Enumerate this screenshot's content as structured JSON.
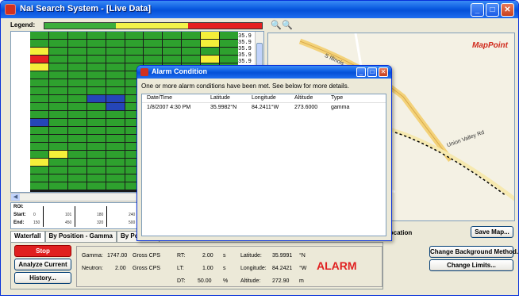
{
  "window": {
    "title": "NaI Search System - [Live Data]",
    "minimize": "_",
    "maximize": "□",
    "close": "✕"
  },
  "legend": {
    "label": "Legend:",
    "segments": [
      {
        "color": "#3cae3c",
        "fraction": 0.33
      },
      {
        "color": "#f3f349",
        "fraction": 0.33
      },
      {
        "color": "#e62020",
        "fraction": 0.34
      }
    ]
  },
  "waterfall": {
    "side_values": [
      "35.9",
      "35.9",
      "35.9",
      "35.9",
      "35.9"
    ],
    "rows": [
      "GGGGGGGGGYG",
      "GGGGGGGGGYG",
      "YGGGGGGGGGG",
      "RGGGGGGGGYG",
      "YGGGGGGGGGG",
      "GGGGGGGGGGG",
      "GGGGGGGGGGG",
      "GGGGGGGGGGG",
      "GGGBBGGGGGG",
      "GGGGBGGGGGG",
      "GGGGGGGGGBG",
      "BGGGGGGGGGG",
      "GGGGGGGGGBG",
      "GGGGGGGBBGG",
      "GGGGGGGGBGG",
      "GYGGGGGGGGG",
      "YGGGGGGGGGG",
      "GGGGGGGGGGG",
      "GGGGGGGGGGG",
      "GGGGGGGGGBG"
    ],
    "colors": {
      "G": "#2ea12e",
      "Y": "#f5ef3a",
      "R": "#e62020",
      "B": "#2546b8"
    },
    "roi_label": "ROI:",
    "start_label": "Start:",
    "end_label": "End:",
    "roi_starts": [
      "0",
      "101",
      "180",
      "240",
      "300"
    ],
    "roi_ends": [
      "150",
      "450",
      "320",
      "500",
      "420"
    ]
  },
  "tabs": [
    "Waterfall",
    "By Position - Gamma",
    "By Position"
  ],
  "buttons": {
    "stop": "Stop",
    "analyze": "Analyze Current",
    "history": "History...",
    "save_map": "Save Map...",
    "change_bg": "Change Background Method...",
    "change_limits": "Change Limits..."
  },
  "readings": {
    "gamma_label": "Gamma:",
    "gamma_value": "1747.00",
    "gamma_unit": "Gross CPS",
    "neutron_label": "Neutron:",
    "neutron_value": "2.00",
    "neutron_unit": "Gross CPS",
    "rt_label": "RT:",
    "rt_value": "2.00",
    "rt_unit": "s",
    "lt_label": "LT:",
    "lt_value": "1.00",
    "lt_unit": "s",
    "dt_label": "DT:",
    "dt_value": "50.00",
    "dt_unit": "%",
    "lat_label": "Latitude:",
    "lat_value": "35.9991",
    "lat_unit": "°N",
    "lon_label": "Longitude:",
    "lon_value": "84.2421",
    "lon_unit": "°W",
    "alt_label": "Altitude:",
    "alt_value": "272.90",
    "alt_unit": "m",
    "alarm": "ALARM"
  },
  "map": {
    "brand": "MapPoint",
    "roads": [
      "Union Valley Rd",
      "S Illinois"
    ],
    "zoom_out": "🔍",
    "zoom_in": "🔍",
    "location_label": "t Location"
  },
  "dialog": {
    "title": "Alarm Condition",
    "message": "One or more alarm conditions have been met. See below for more details.",
    "columns": [
      "Date/Time",
      "Latitude",
      "Longitude",
      "Altitude",
      "Type"
    ],
    "rows": [
      [
        "1/8/2007 4:30 PM",
        "35.9982°N",
        "84.2411°W",
        "273.6000",
        "gamma"
      ]
    ]
  }
}
